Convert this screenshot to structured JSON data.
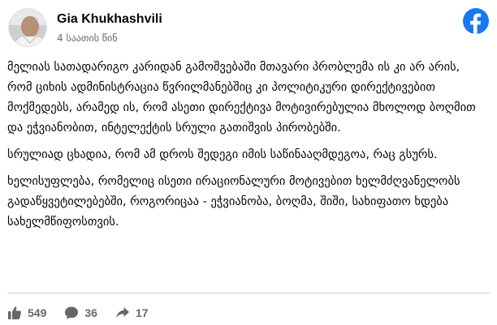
{
  "post": {
    "author": "Gia Khukhashvili",
    "time": "4 საათის წინ",
    "paragraphs": [
      "მელიას სათადარიგო კარიდან გამოშვებაში მთავარი პრობლემა ის კი არ არის, რომ ციხის ადმინისტრაცია წვრილმანებშიც კი პოლიტიკური დირექტივებით მოქმედებს, არამედ ის, რომ ასეთი დირექტივა მოტივირებულია მხოლოდ ბოღმით და ეჭვიანობით, ინტელექტის სრული გათიშვის პირობებში.",
      "სრულიად ცხადია, რომ ამ დროს შედეგი იმის საწინააღმდეგოა, რაც გსურს.",
      "ხელისუფლება, რომელიც ისეთი ირაციონალური მოტივებით ხელმძღვანელობს გადაწყვეტილებებში, როგორიცაა - ეჭვიანობა, ბოღმა, შიში, სახიფათო ხდება სახელმწიფოსთვის."
    ],
    "stats": {
      "likes": "549",
      "comments": "36",
      "shares": "17"
    },
    "icons": {
      "platform": "facebook-logo-icon",
      "likes": "thumbs-up-icon",
      "comments": "comment-icon",
      "shares": "share-icon"
    },
    "colors": {
      "facebook_blue": "#1877f2",
      "meta_gray": "#65676b",
      "text": "#050505"
    }
  }
}
